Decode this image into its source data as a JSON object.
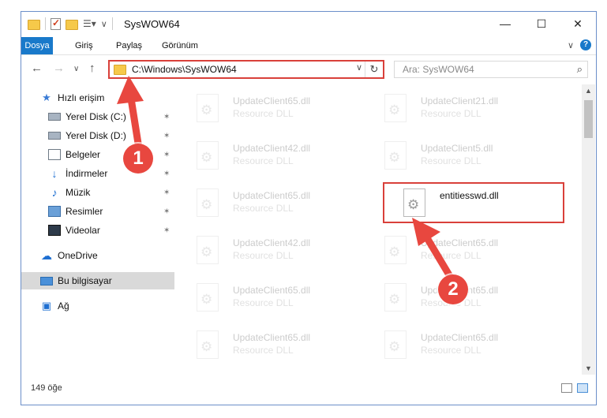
{
  "window": {
    "title": "SysWOW64"
  },
  "window_buttons": {
    "minimize": "—",
    "maximize": "☐",
    "close": "✕"
  },
  "ribbon": {
    "tabs": [
      {
        "label": "Dosya"
      },
      {
        "label": "Giriş"
      },
      {
        "label": "Paylaş"
      },
      {
        "label": "Görünüm"
      }
    ],
    "expand_glyph": "∨",
    "help_glyph": "?"
  },
  "nav": {
    "back_glyph": "←",
    "forward_glyph": "→",
    "recent_glyph": "∨",
    "up_glyph": "↑"
  },
  "address": {
    "path": "C:\\Windows\\SysWOW64",
    "dropdown_glyph": "∨",
    "refresh_glyph": "↻"
  },
  "search": {
    "placeholder": "Ara: SysWOW64",
    "icon_glyph": "⌕"
  },
  "sidebar": {
    "items": [
      {
        "label": "Hızlı erişim",
        "icon": "star-icon",
        "pinned": false
      },
      {
        "label": "Yerel Disk (C:)",
        "icon": "disk-icon",
        "pinned": true
      },
      {
        "label": "Yerel Disk (D:)",
        "icon": "disk-icon",
        "pinned": true
      },
      {
        "label": "Belgeler",
        "icon": "documents-icon",
        "pinned": true
      },
      {
        "label": "İndirmeler",
        "icon": "downloads-icon",
        "pinned": true
      },
      {
        "label": "Müzik",
        "icon": "music-icon",
        "pinned": true
      },
      {
        "label": "Resimler",
        "icon": "pictures-icon",
        "pinned": true
      },
      {
        "label": "Videolar",
        "icon": "videos-icon",
        "pinned": true
      },
      {
        "label": "OneDrive",
        "icon": "cloud-icon",
        "pinned": false
      },
      {
        "label": "Bu bilgisayar",
        "icon": "computer-icon",
        "pinned": false,
        "selected": true
      },
      {
        "label": "Ağ",
        "icon": "network-icon",
        "pinned": false
      }
    ],
    "pin_glyph": "✶"
  },
  "files": [
    {
      "name": "UpdateClient65.dll",
      "type": "Resource DLL"
    },
    {
      "name": "UpdateClient21.dll",
      "type": "Resource DLL"
    },
    {
      "name": "UpdateClient42.dll",
      "type": "Resource DLL"
    },
    {
      "name": "UpdateClient5.dll",
      "type": "Resource DLL"
    },
    {
      "name": "UpdateClient65.dll",
      "type": "Resource DLL"
    },
    {
      "name": "entitiesswd.dll",
      "type": "",
      "highlighted": true
    },
    {
      "name": "UpdateClient42.dll",
      "type": "Resource DLL"
    },
    {
      "name": "UpdateClient65.dll",
      "type": "Resource DLL"
    },
    {
      "name": "UpdateClient65.dll",
      "type": "Resource DLL"
    },
    {
      "name": "UpdateClient65.dll",
      "type": "Resource DLL"
    },
    {
      "name": "UpdateClient65.dll",
      "type": "Resource DLL"
    },
    {
      "name": "UpdateClient65.dll",
      "type": "Resource DLL"
    }
  ],
  "scrollbar": {
    "up_glyph": "▲",
    "down_glyph": "▼"
  },
  "status": {
    "item_count": "149 öğe"
  },
  "annotations": [
    {
      "number": "1",
      "color": "#e8473f"
    },
    {
      "number": "2",
      "color": "#e8473f"
    }
  ],
  "colors": {
    "accent": "#1979ca",
    "highlight_border": "#d9403a",
    "arrow": "#e8473f"
  }
}
